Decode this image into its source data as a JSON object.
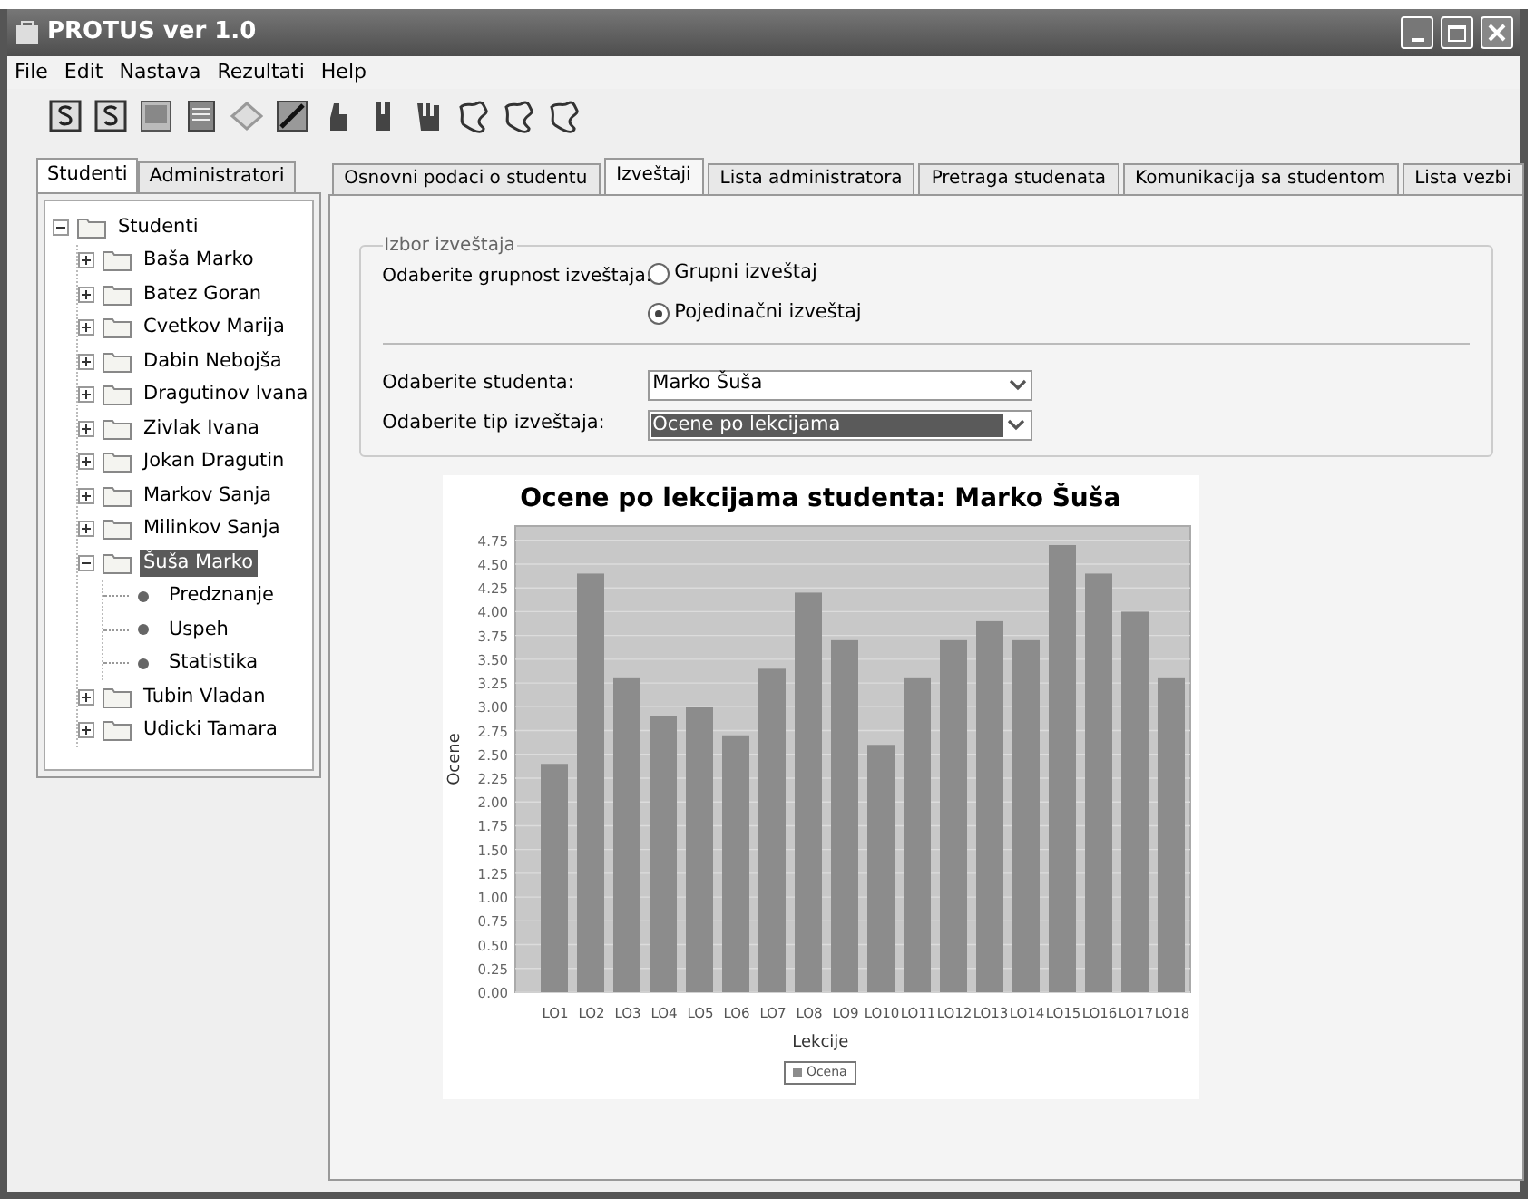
{
  "window": {
    "title": "PROTUS ver 1.0"
  },
  "menu": [
    "File",
    "Edit",
    "Nastava",
    "Rezultati",
    "Help"
  ],
  "left_tabs": [
    {
      "label": "Studenti",
      "selected": true
    },
    {
      "label": "Administratori",
      "selected": false
    }
  ],
  "tree": [
    {
      "label": "Studenti",
      "kind": "folder",
      "expanded": true,
      "selected": false,
      "children": [
        {
          "label": "Baša Marko",
          "kind": "folder",
          "expanded": false,
          "selected": false
        },
        {
          "label": "Batez Goran",
          "kind": "folder",
          "expanded": false,
          "selected": false
        },
        {
          "label": "Cvetkov Marija",
          "kind": "folder",
          "expanded": false,
          "selected": false
        },
        {
          "label": "Dabin Nebojša",
          "kind": "folder",
          "expanded": false,
          "selected": false
        },
        {
          "label": "Dragutinov Ivana",
          "kind": "folder",
          "expanded": false,
          "selected": false
        },
        {
          "label": "Zivlak Ivana",
          "kind": "folder",
          "expanded": false,
          "selected": false
        },
        {
          "label": "Jokan Dragutin",
          "kind": "folder",
          "expanded": false,
          "selected": false
        },
        {
          "label": "Markov Sanja",
          "kind": "folder",
          "expanded": false,
          "selected": false
        },
        {
          "label": "Milinkov Sanja",
          "kind": "folder",
          "expanded": false,
          "selected": false
        },
        {
          "label": "Šuša Marko",
          "kind": "folder",
          "expanded": true,
          "selected": true,
          "children": [
            {
              "label": "Predznanje",
              "kind": "leaf",
              "selected": false
            },
            {
              "label": "Uspeh",
              "kind": "leaf",
              "selected": false
            },
            {
              "label": "Statistika",
              "kind": "leaf",
              "selected": false
            }
          ]
        },
        {
          "label": "Tubin Vladan",
          "kind": "folder",
          "expanded": false,
          "selected": false
        },
        {
          "label": "Udicki Tamara",
          "kind": "folder",
          "expanded": false,
          "selected": false
        }
      ]
    }
  ],
  "tabs": [
    {
      "label": "Osnovni podaci o studentu",
      "selected": false
    },
    {
      "label": "Izveštaji",
      "selected": true
    },
    {
      "label": "Lista administratora",
      "selected": false
    },
    {
      "label": "Pretraga studenata",
      "selected": false
    },
    {
      "label": "Komunikacija sa studentom",
      "selected": false
    },
    {
      "label": "Lista vezbi",
      "selected": false
    }
  ],
  "report": {
    "group_title": "Izbor izveštaja",
    "grouping_label": "Odaberite grupnost izveštaja:",
    "grouping_options": [
      {
        "label": "Grupni izveštaj",
        "selected": false
      },
      {
        "label": "Pojedinačni izveštaj",
        "selected": true
      }
    ],
    "student_label": "Odaberite studenta:",
    "student_value": "Marko Šuša",
    "type_label": "Odaberite tip izveštaja:",
    "type_value": "Ocene po lekcijama",
    "chart_data": {
      "type": "bar",
      "title": "Ocene po lekcijama studenta: Marko Šuša",
      "xlabel": "Lekcije",
      "ylabel": "Ocene",
      "categories": [
        "LO1",
        "LO2",
        "LO3",
        "LO4",
        "LO5",
        "LO6",
        "LO7",
        "LO8",
        "LO9",
        "LO10",
        "LO11",
        "LO12",
        "LO13",
        "LO14",
        "LO15",
        "LO16",
        "LO17",
        "LO18"
      ],
      "series": [
        {
          "name": "Ocena",
          "color": "#8c8c8c",
          "values": [
            2.4,
            4.4,
            3.3,
            2.9,
            3.0,
            2.7,
            3.4,
            4.2,
            3.7,
            2.6,
            3.3,
            3.7,
            3.9,
            3.7,
            4.7,
            4.4,
            4.0,
            3.3
          ]
        }
      ],
      "ylim": [
        0,
        4.9
      ],
      "grid": true,
      "yticks": [
        {
          "value": 0,
          "label": "0.00"
        },
        {
          "value": 0.25,
          "label": "0.25"
        },
        {
          "value": 0.5,
          "label": "0.50"
        },
        {
          "value": 0.75,
          "label": "0.75"
        },
        {
          "value": 1,
          "label": "1.00"
        },
        {
          "value": 1.25,
          "label": "1.25"
        },
        {
          "value": 1.5,
          "label": "1.50"
        },
        {
          "value": 1.75,
          "label": "1.75"
        },
        {
          "value": 2,
          "label": "2.00"
        },
        {
          "value": 2.25,
          "label": "2.25"
        },
        {
          "value": 2.5,
          "label": "2.50"
        },
        {
          "value": 2.75,
          "label": "2.75"
        },
        {
          "value": 3,
          "label": "3.00"
        },
        {
          "value": 3.25,
          "label": "3.25"
        },
        {
          "value": 3.5,
          "label": "3.50"
        },
        {
          "value": 3.75,
          "label": "3.75"
        },
        {
          "value": 4,
          "label": "4.00"
        },
        {
          "value": 4.25,
          "label": "4.25"
        },
        {
          "value": 4.5,
          "label": "4.50"
        },
        {
          "value": 4.75,
          "label": "4.75"
        }
      ]
    }
  }
}
